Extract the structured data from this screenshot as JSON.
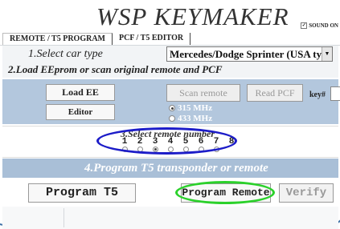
{
  "app": {
    "title": "WSP  KEYMAKER"
  },
  "options": {
    "sound_label": "SOUND ON",
    "sound_checked": true
  },
  "tabs": [
    {
      "label": "REMOTE / T5 PROGRAM",
      "active": true
    },
    {
      "label": "PCF / T5  EDITOR",
      "active": false
    }
  ],
  "step1": {
    "label": "1.Select car type",
    "selected_car": "Mercedes/Dodge Sprinter (USA type)"
  },
  "step2": {
    "label": "2.Load EEprom or scan original remote and PCF",
    "load_ee": "Load EE",
    "editor": "Editor",
    "scan_remote": "Scan remote",
    "read_pcf": "Read PCF",
    "key_label": "key#",
    "key_value": "",
    "freq_options": [
      {
        "label": "315 MHz",
        "selected": true
      },
      {
        "label": "433 MHz",
        "selected": false
      }
    ]
  },
  "step3": {
    "label": "3.Select remote number",
    "numbers": [
      "1",
      "2",
      "3",
      "4",
      "5",
      "6",
      "7",
      "8"
    ],
    "selected": "3"
  },
  "step4": {
    "label": "4.Program T5 transponder or remote",
    "program_t5": "Program T5",
    "program_remote": "Program Remote",
    "verify": "Verify"
  },
  "colors": {
    "panel_blue": "#b3c7dd",
    "accent_blue": "#1c1cc8",
    "accent_green": "#2bd12b"
  }
}
